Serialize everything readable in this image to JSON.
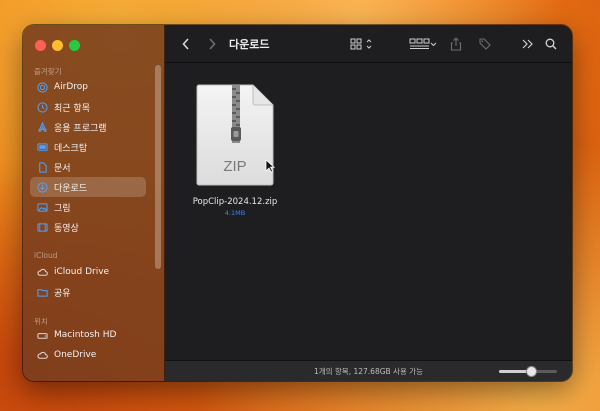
{
  "sidebar": {
    "sections": [
      {
        "label": "즐겨찾기",
        "items": [
          {
            "label": "AirDrop",
            "icon": "airdrop-icon"
          },
          {
            "label": "최근 항목",
            "icon": "clock-icon"
          },
          {
            "label": "응용 프로그램",
            "icon": "applications-icon"
          },
          {
            "label": "데스크탑",
            "icon": "desktop-icon"
          },
          {
            "label": "문서",
            "icon": "document-icon"
          },
          {
            "label": "다운로드",
            "icon": "download-icon",
            "selected": true
          },
          {
            "label": "그림",
            "icon": "photo-icon"
          },
          {
            "label": "동영상",
            "icon": "video-icon"
          }
        ]
      },
      {
        "label": "iCloud",
        "items": [
          {
            "label": "iCloud Drive",
            "icon": "cloud-icon"
          },
          {
            "label": "공유",
            "icon": "shared-folder-icon"
          }
        ]
      },
      {
        "label": "위치",
        "items": [
          {
            "label": "Macintosh HD",
            "icon": "hard-drive-icon"
          },
          {
            "label": "OneDrive",
            "icon": "cloud-icon"
          }
        ]
      }
    ]
  },
  "toolbar": {
    "title": "다운로드",
    "back_icon": "chevron-left-icon",
    "forward_icon": "chevron-right-icon",
    "view_icon": "grid-view-icon",
    "group_icon": "group-icon",
    "share_icon": "share-icon",
    "tag_icon": "tag-icon",
    "more_icon": "chevron-double-right-icon",
    "search_icon": "search-icon"
  },
  "files": [
    {
      "name": "PopClip-2024.12.zip",
      "size": "4.1MB",
      "type_label": "ZIP"
    }
  ],
  "status": {
    "text": "1개의 항목, 127.68GB 사용 가능",
    "icon_size_level": 0.55
  },
  "colors": {
    "accent": "#3b82f6",
    "sidebar": "#783e1e",
    "content": "#1e1e20"
  }
}
